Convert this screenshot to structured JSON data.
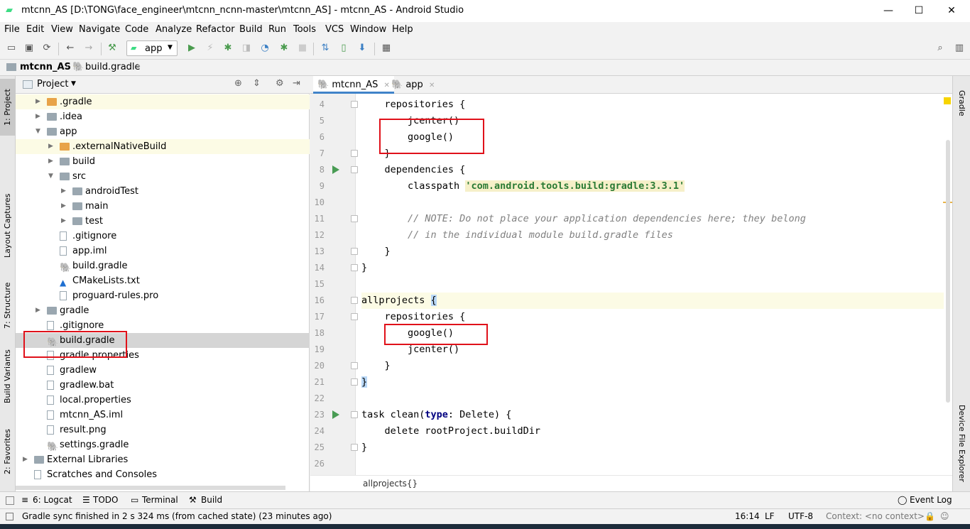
{
  "window": {
    "title": "mtcnn_AS [D:\\TONG\\face_engineer\\mtcnn_ncnn-master\\mtcnn_AS] - mtcnn_AS - Android Studio",
    "minimize": "—",
    "maximize": "☐",
    "close": "✕"
  },
  "menu": [
    "File",
    "Edit",
    "View",
    "Navigate",
    "Code",
    "Analyze",
    "Refactor",
    "Build",
    "Run",
    "Tools",
    "VCS",
    "Window",
    "Help"
  ],
  "toolbar": {
    "run_config": "app",
    "icons": [
      "open-icon",
      "save-icon",
      "sync-icon",
      "back-icon",
      "forward-icon",
      "make-icon",
      "run-icon",
      "apply-changes-icon",
      "debug-icon",
      "attach-debugger-icon",
      "profile-icon",
      "debug-attach-icon",
      "stop-icon",
      "gradle-sync-icon",
      "avd-manager-icon",
      "sdk-manager-icon",
      "project-structure-icon",
      "search-icon"
    ]
  },
  "breadcrumb": {
    "project": "mtcnn_AS",
    "file": "build.gradle"
  },
  "left_tool_tabs": {
    "project": "1: Project",
    "layout_captures": "Layout Captures",
    "structure": "7: Structure",
    "build_variants": "Build Variants",
    "favorites": "2: Favorites"
  },
  "right_tool_tabs": {
    "gradle": "Gradle",
    "device_file_explorer": "Device File Explorer"
  },
  "project_panel": {
    "view_selector": "Project",
    "tree": [
      {
        "label": ".gradle",
        "depth": 1,
        "icon": "folder-orange",
        "arrow": "▶",
        "hl": true
      },
      {
        "label": ".idea",
        "depth": 1,
        "icon": "folder",
        "arrow": "▶"
      },
      {
        "label": "app",
        "depth": 1,
        "icon": "folder",
        "arrow": "▼"
      },
      {
        "label": ".externalNativeBuild",
        "depth": 2,
        "icon": "folder-orange",
        "arrow": "▶",
        "hl": true
      },
      {
        "label": "build",
        "depth": 2,
        "icon": "folder",
        "arrow": "▶"
      },
      {
        "label": "src",
        "depth": 2,
        "icon": "folder",
        "arrow": "▼"
      },
      {
        "label": "androidTest",
        "depth": 3,
        "icon": "folder",
        "arrow": "▶"
      },
      {
        "label": "main",
        "depth": 3,
        "icon": "folder",
        "arrow": "▶"
      },
      {
        "label": "test",
        "depth": 3,
        "icon": "folder",
        "arrow": "▶"
      },
      {
        "label": ".gitignore",
        "depth": 2,
        "icon": "file",
        "arrow": ""
      },
      {
        "label": "app.iml",
        "depth": 2,
        "icon": "file",
        "arrow": ""
      },
      {
        "label": "build.gradle",
        "depth": 2,
        "icon": "gradle",
        "arrow": ""
      },
      {
        "label": "CMakeLists.txt",
        "depth": 2,
        "icon": "cmake",
        "arrow": ""
      },
      {
        "label": "proguard-rules.pro",
        "depth": 2,
        "icon": "file",
        "arrow": ""
      },
      {
        "label": "gradle",
        "depth": 1,
        "icon": "folder",
        "arrow": "▶"
      },
      {
        "label": ".gitignore",
        "depth": 1,
        "icon": "file",
        "arrow": ""
      },
      {
        "label": "build.gradle",
        "depth": 1,
        "icon": "gradle",
        "arrow": "",
        "sel": true
      },
      {
        "label": "gradle.properties",
        "depth": 1,
        "icon": "file",
        "arrow": ""
      },
      {
        "label": "gradlew",
        "depth": 1,
        "icon": "file",
        "arrow": ""
      },
      {
        "label": "gradlew.bat",
        "depth": 1,
        "icon": "file",
        "arrow": ""
      },
      {
        "label": "local.properties",
        "depth": 1,
        "icon": "file",
        "arrow": ""
      },
      {
        "label": "mtcnn_AS.iml",
        "depth": 1,
        "icon": "file",
        "arrow": ""
      },
      {
        "label": "result.png",
        "depth": 1,
        "icon": "file",
        "arrow": ""
      },
      {
        "label": "settings.gradle",
        "depth": 1,
        "icon": "gradle",
        "arrow": ""
      },
      {
        "label": "External Libraries",
        "depth": 0,
        "icon": "folder",
        "arrow": "▶"
      },
      {
        "label": "Scratches and Consoles",
        "depth": 0,
        "icon": "file",
        "arrow": ""
      }
    ]
  },
  "editor": {
    "tabs": [
      {
        "label": "mtcnn_AS",
        "active": true
      },
      {
        "label": "app",
        "active": false
      }
    ],
    "first_line": 4,
    "lines": [
      "    repositories {",
      "        jcenter()",
      "        google()",
      "    }",
      "    dependencies {",
      "        classpath 'com.android.tools.build:gradle:3.3.1'",
      "",
      "        // NOTE: Do not place your application dependencies here; they belong",
      "        // in the individual module build.gradle files",
      "    }",
      "}",
      "",
      "allprojects {",
      "    repositories {",
      "        google()",
      "        jcenter()",
      "    }",
      "}",
      "",
      "task clean(type: Delete) {",
      "    delete rootProject.buildDir",
      "}",
      ""
    ],
    "crumb": "allprojects{}"
  },
  "bottom_tabs": [
    "6: Logcat",
    "TODO",
    "Terminal",
    "Build"
  ],
  "event_log": "Event Log",
  "status": {
    "message": "Gradle sync finished in 2 s 324 ms (from cached state) (23 minutes ago)",
    "position": "16:14",
    "line_sep": "LF",
    "encoding": "UTF-8",
    "context": "Context: <no context>"
  },
  "colors": {
    "annotation_red": "#e0111a",
    "selection_gray": "#d5d5d5",
    "highlight_yellow": "#fcfbe5",
    "active_tab_blue": "#4083c9"
  }
}
